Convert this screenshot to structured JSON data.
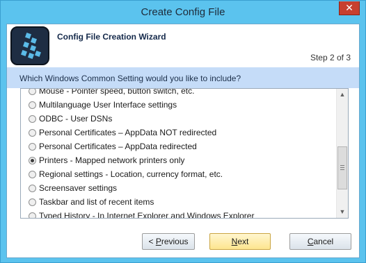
{
  "window": {
    "title": "Create Config File",
    "close_label": "✕"
  },
  "header": {
    "wizard_title": "Config File Creation Wizard",
    "step": "Step 2 of 3"
  },
  "question": "Which Windows Common Setting would you like to include?",
  "options": [
    {
      "label": "Mouse - Pointer speed, button switch, etc.",
      "selected": false
    },
    {
      "label": "Multilanguage User Interface settings",
      "selected": false
    },
    {
      "label": "ODBC - User DSNs",
      "selected": false
    },
    {
      "label": "Personal Certificates – AppData NOT redirected",
      "selected": false
    },
    {
      "label": "Personal Certificates – AppData redirected",
      "selected": false
    },
    {
      "label": "Printers - Mapped network printers only",
      "selected": true
    },
    {
      "label": "Regional settings - Location, currency format, etc.",
      "selected": false
    },
    {
      "label": "Screensaver settings",
      "selected": false
    },
    {
      "label": "Taskbar and list of recent items",
      "selected": false
    },
    {
      "label": "Typed History - In Internet Explorer and Windows Explorer",
      "selected": false
    }
  ],
  "buttons": {
    "previous": {
      "lead": "< ",
      "mnemonic": "P",
      "rest": "revious"
    },
    "next": {
      "mnemonic": "N",
      "rest": "ext"
    },
    "cancel": {
      "mnemonic": "C",
      "rest": "ancel"
    }
  },
  "icons": {
    "close": "close-icon",
    "scroll_up": "chevron-up-icon",
    "scroll_down": "chevron-down-icon",
    "logo": "app-logo-icon"
  },
  "colors": {
    "frame": "#5bc3ee",
    "question_band": "#c5dcf8",
    "next_button": "#fde58f"
  }
}
